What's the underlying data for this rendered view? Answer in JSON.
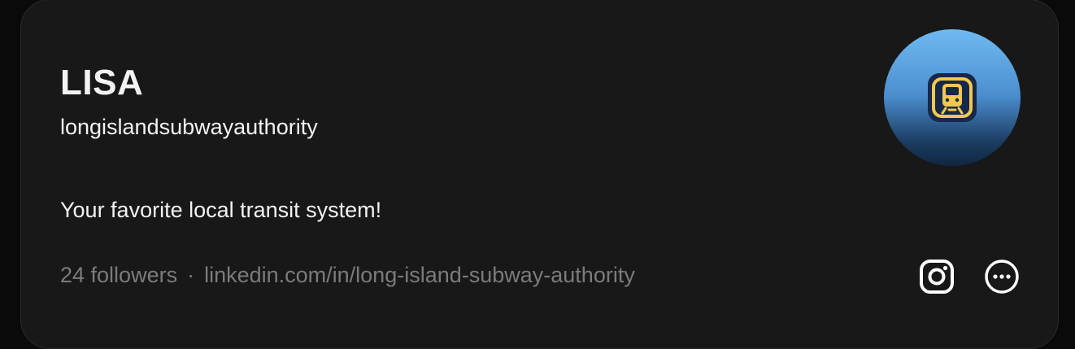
{
  "profile": {
    "name": "LISA",
    "username": "longislandsubwayauthority",
    "bio": "Your favorite local transit system!",
    "followers": "24 followers",
    "separator": "·",
    "link": "linkedin.com/in/long-island-subway-authority"
  },
  "icons": {
    "avatar": "subway-train-icon",
    "instagram": "instagram-icon",
    "more": "more-options-icon"
  },
  "colors": {
    "card_background": "#181818",
    "text_primary": "#f3f3f3",
    "text_secondary": "#7b7b7b",
    "avatar_icon_accent": "#f2c94c"
  }
}
